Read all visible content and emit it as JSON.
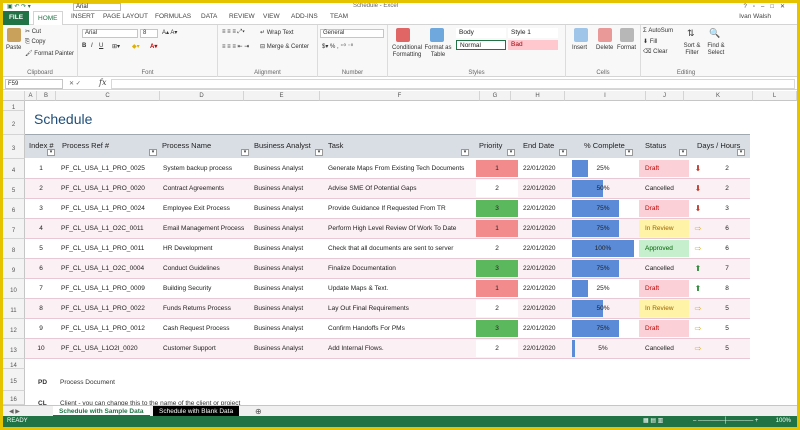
{
  "window": {
    "title": "Schedule - Excel",
    "font_box": "Arial",
    "user": "Ivan Walsh"
  },
  "ribbon_tabs": [
    "FILE",
    "HOME",
    "INSERT",
    "PAGE LAYOUT",
    "FORMULAS",
    "DATA",
    "REVIEW",
    "VIEW",
    "ADD-INS",
    "TEAM"
  ],
  "ribbon": {
    "clipboard": {
      "paste": "Paste",
      "cut": "Cut",
      "copy": "Copy",
      "format_painter": "Format Painter",
      "label": "Clipboard"
    },
    "font": {
      "family": "Arial",
      "size": "8",
      "label": "Font"
    },
    "alignment": {
      "wrap": "Wrap Text",
      "merge": "Merge & Center",
      "label": "Alignment"
    },
    "number": {
      "format": "General",
      "label": "Number"
    },
    "styles": {
      "conditional": "Conditional Formatting",
      "format_table": "Format as Table",
      "body": "Body",
      "style1": "Style 1",
      "normal": "Normal",
      "bad": "Bad",
      "label": "Styles"
    },
    "cells": {
      "insert": "Insert",
      "delete": "Delete",
      "format": "Format",
      "label": "Cells"
    },
    "editing": {
      "autosum": "AutoSum",
      "fill": "Fill",
      "clear": "Clear",
      "sort": "Sort & Filter",
      "find": "Find & Select",
      "label": "Editing"
    }
  },
  "formula_bar": {
    "name_box": "F59",
    "fx": "fx"
  },
  "columns": [
    "A",
    "B",
    "C",
    "D",
    "E",
    "F",
    "G",
    "H",
    "I",
    "J",
    "K",
    "L"
  ],
  "sheet_title": "Schedule",
  "table": {
    "headers": [
      "Index #",
      "Process Ref #",
      "Process Name",
      "Business Analyst",
      "Task",
      "Priority",
      "End Date",
      "% Complete",
      "Status",
      "Days / Hours"
    ],
    "rows": [
      {
        "index": "1",
        "ref": "PF_CL_USA_L1_PRO_0025",
        "name": "System backup process",
        "analyst": "Business Analyst",
        "task": "Generate  Maps From Existing Tech Documents",
        "priority": "1",
        "end": "22/01/2020",
        "complete": 25,
        "complete_label": "25%",
        "status": "Draft",
        "arrow": "down",
        "days": "2"
      },
      {
        "index": "2",
        "ref": "PF_CL_USA_L1_PRO_0020",
        "name": "Contract Agreements",
        "analyst": "Business Analyst",
        "task": "Advise SME Of Potential Gaps",
        "priority": "2",
        "end": "22/01/2020",
        "complete": 50,
        "complete_label": "50%",
        "status": "Cancelled",
        "arrow": "down",
        "days": "2"
      },
      {
        "index": "3",
        "ref": "PF_CL_USA_L1_PRO_0024",
        "name": "Employee Exit Process",
        "analyst": "Business Analyst",
        "task": "Provide Guidance If Requested From TR",
        "priority": "3",
        "end": "22/01/2020",
        "complete": 75,
        "complete_label": "75%",
        "status": "Draft",
        "arrow": "down",
        "days": "3"
      },
      {
        "index": "4",
        "ref": "PF_CL_USA_L1_O2C_0011",
        "name": "Email Management Process",
        "analyst": "Business Analyst",
        "task": "Perform High Level Review Of Work To Date",
        "priority": "1",
        "end": "22/01/2020",
        "complete": 75,
        "complete_label": "75%",
        "status": "In Review",
        "arrow": "right",
        "days": "6"
      },
      {
        "index": "5",
        "ref": "PF_CL_USA_L1_PRO_0011",
        "name": "HR Development",
        "analyst": "Business Analyst",
        "task": "Check that all documents are sent to server",
        "priority": "2",
        "end": "22/01/2020",
        "complete": 100,
        "complete_label": "100%",
        "status": "Approved",
        "arrow": "right",
        "days": "6"
      },
      {
        "index": "6",
        "ref": "PF_CL_USA_L1_O2C_0004",
        "name": "Conduct Guidelines",
        "analyst": "Business Analyst",
        "task": "Finalize Documentation",
        "priority": "3",
        "end": "22/01/2020",
        "complete": 75,
        "complete_label": "75%",
        "status": "Cancelled",
        "arrow": "up",
        "days": "7"
      },
      {
        "index": "7",
        "ref": "PF_CL_USA_L1_PRO_0009",
        "name": "Building Security",
        "analyst": "Business Analyst",
        "task": "Update Maps & Text.",
        "priority": "1",
        "end": "22/01/2020",
        "complete": 25,
        "complete_label": "25%",
        "status": "Draft",
        "arrow": "up",
        "days": "8"
      },
      {
        "index": "8",
        "ref": "PF_CL_USA_L1_PRO_0022",
        "name": "Funds Returns Process",
        "analyst": "Business Analyst",
        "task": "Lay Out Final Requirements",
        "priority": "2",
        "end": "22/01/2020",
        "complete": 50,
        "complete_label": "50%",
        "status": "In Review",
        "arrow": "right",
        "days": "5"
      },
      {
        "index": "9",
        "ref": "PF_CL_USA_L1_PRO_0012",
        "name": "Cash Request Process",
        "analyst": "Business Analyst",
        "task": "Confirm Handoffs For PMs",
        "priority": "3",
        "end": "22/01/2020",
        "complete": 75,
        "complete_label": "75%",
        "status": "Draft",
        "arrow": "right",
        "days": "5"
      },
      {
        "index": "10",
        "ref": "PF_CL_USA_L1O2I_0020",
        "name": "Customer Support",
        "analyst": "Business Analyst",
        "task": "Add Internal Flows.",
        "priority": "2",
        "end": "22/01/2020",
        "complete": 5,
        "complete_label": "5%",
        "status": "Cancelled",
        "arrow": "right",
        "days": "5"
      }
    ]
  },
  "notes": {
    "pd_key": "PD",
    "pd_text": "Process Document",
    "cl_key": "CL",
    "cl_text": "Client - you can change this to the name of the client or project"
  },
  "sheet_tabs": [
    "Schedule with Sample Data",
    "Schedule with Blank Data"
  ],
  "status_bar": {
    "ready": "READY",
    "zoom": "100%"
  },
  "colors": {
    "excel_green": "#217346",
    "priority_1": "#f28b8b",
    "priority_2": "#ffffff",
    "priority_3": "#5cb85c",
    "bar": "#5b8bd6",
    "status_draft": "#fbd0d6",
    "status_review": "#fff3a8",
    "status_approved": "#c6efce"
  }
}
